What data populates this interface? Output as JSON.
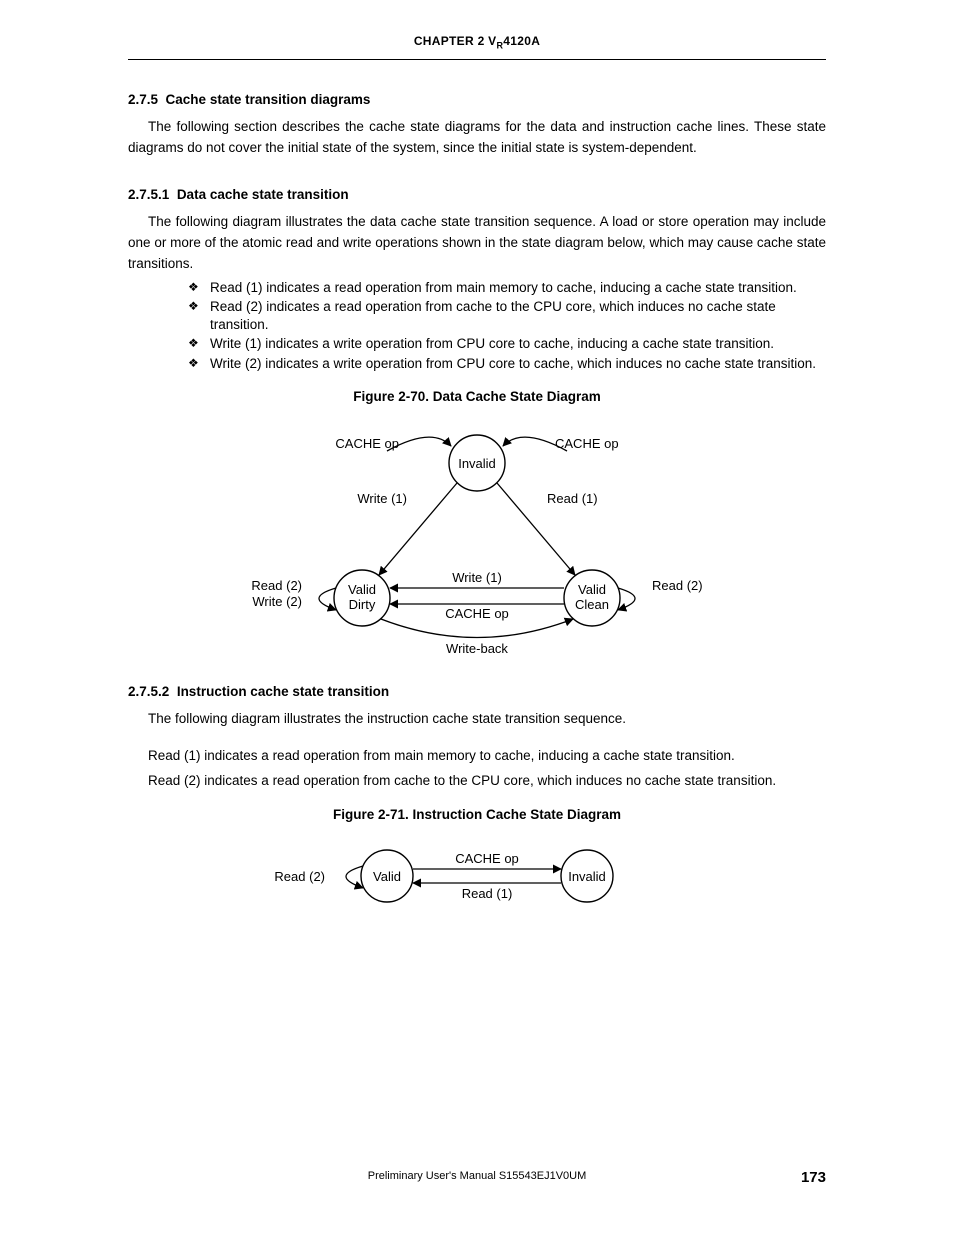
{
  "header": {
    "chapter": "CHAPTER 2  V",
    "sub": "R",
    "tail": "4120A"
  },
  "sec_275": {
    "num": "2.7.5",
    "title": "Cache state transition diagrams",
    "p": "The following section describes the cache state diagrams for the data and instruction cache lines.  These state diagrams do not cover the initial state of the system, since the initial state is system-dependent."
  },
  "sec_2751": {
    "num": "2.7.5.1",
    "title": "Data cache state transition",
    "p": "The following diagram illustrates the data cache state transition sequence.  A load or store operation may include one or more of the atomic read and write operations shown in the state diagram below, which may cause cache state transitions."
  },
  "bullets": [
    "Read (1) indicates a read operation from main memory to cache, inducing a cache state transition.",
    "Read (2) indicates a read operation from cache to the CPU core, which induces no cache state transition.",
    "Write (1) indicates a write operation from CPU core to cache, inducing a cache state transition.",
    "Write (2) indicates a write operation from CPU core to cache, which induces no cache state transition."
  ],
  "fig70": {
    "title": "Figure 2-70.  Data Cache State Diagram",
    "states": {
      "inv": "Invalid",
      "vd1": "Valid",
      "vd2": "Dirty",
      "vc1": "Valid",
      "vc2": "Clean"
    },
    "labels": {
      "cacheop": "CACHE op",
      "w1": "Write (1)",
      "r1": "Read (1)",
      "r2": "Read (2)",
      "w2": "Write (2)",
      "wb": "Write-back"
    }
  },
  "sec_2752": {
    "num": "2.7.5.2",
    "title": "Instruction cache state transition",
    "p": "The following diagram illustrates the instruction cache state transition sequence.",
    "p2": "Read (1) indicates a read operation from main memory to cache, inducing a cache state transition.",
    "p3": "Read (2) indicates a read operation from cache to the CPU core, which induces no cache state transition."
  },
  "fig71": {
    "title": "Figure 2-71.  Instruction Cache State Diagram",
    "states": {
      "valid": "Valid",
      "invalid": "Invalid"
    },
    "labels": {
      "cacheop": "CACHE op",
      "r1": "Read (1)",
      "r2": "Read (2)"
    }
  },
  "footer": {
    "text": "Preliminary User's Manual  S15543EJ1V0UM",
    "page": "173"
  }
}
